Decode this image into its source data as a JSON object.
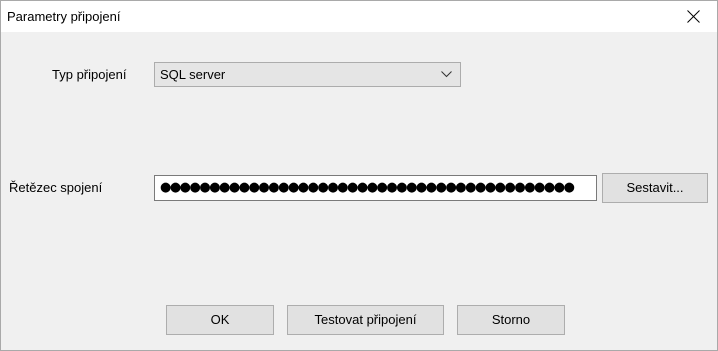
{
  "window": {
    "title": "Parametry připojení"
  },
  "connection_type": {
    "label": "Typ připojení",
    "selected": "SQL server"
  },
  "connection_string": {
    "label": "Řetězec spojení",
    "masked_value": "●●●●●●●●●●●●●●●●●●●●●●●●●●●●●●●●●●●●●●●●●●",
    "build_label": "Sestavit..."
  },
  "buttons": {
    "ok": "OK",
    "test": "Testovat připojení",
    "cancel": "Storno"
  },
  "icons": {
    "close": "close-icon",
    "dropdown": "chevron-down-icon"
  }
}
